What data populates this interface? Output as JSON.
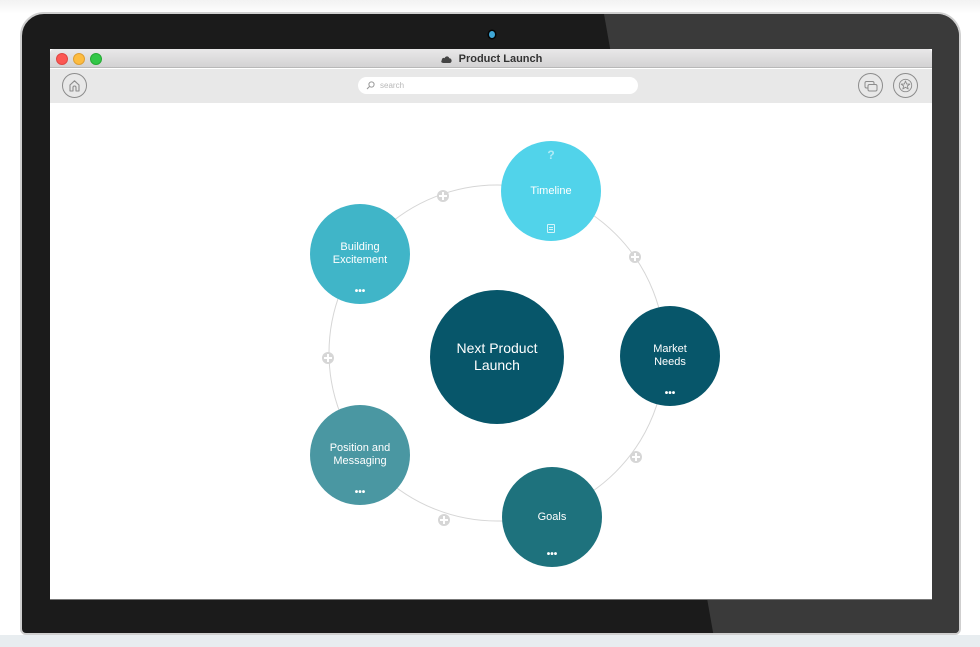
{
  "window": {
    "title": "Product Launch",
    "title_icon": "cloud-icon"
  },
  "toolbar": {
    "home_icon": "home-icon",
    "search_placeholder": "search",
    "search_value": "",
    "search_icon": "search-icon",
    "present_icon": "slides-icon",
    "favorite_icon": "star-badge-icon"
  },
  "mindmap": {
    "center": {
      "label": "Next Product\nLaunch",
      "color": "#07566a"
    },
    "nodes": [
      {
        "id": "timeline",
        "label": "Timeline",
        "color": "#51d3ea",
        "top_icon": "?",
        "bottom_icon": "document-icon"
      },
      {
        "id": "market-needs",
        "label": "Market\nNeeds",
        "color": "#07566a",
        "more": "•••"
      },
      {
        "id": "goals",
        "label": "Goals",
        "color": "#1e727d",
        "more": "•••"
      },
      {
        "id": "position-messaging",
        "label": "Position and\nMessaging",
        "color": "#4a97a2",
        "more": "•••"
      },
      {
        "id": "building-excitement",
        "label": "Building\nExcitement",
        "color": "#40b5c8",
        "more": "•••"
      }
    ],
    "connector_color": "#d6d6d6",
    "add_icon": "plus-icon"
  },
  "colors": {
    "close": "#fc5753",
    "minimize": "#fdbc40",
    "zoom": "#33c748",
    "camera": "#3fa7d6"
  }
}
